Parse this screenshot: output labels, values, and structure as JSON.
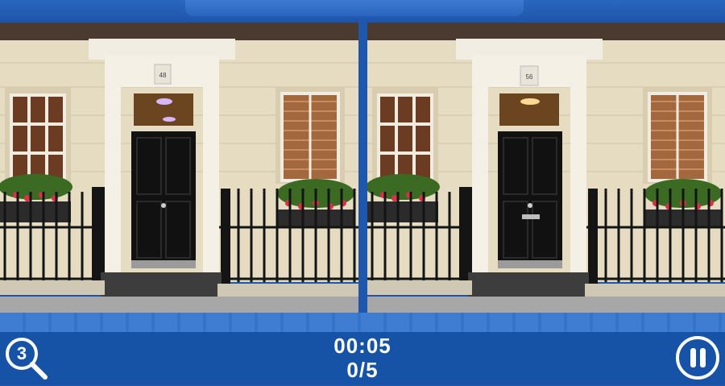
{
  "hud": {
    "timer": "00:05",
    "score": "0/5",
    "hints_remaining": "3"
  },
  "scene": {
    "left_house_number": "48",
    "right_house_number": "56"
  },
  "colors": {
    "frame_blue": "#1f57ad",
    "door_black": "#111111",
    "flower_red": "#d8314a"
  }
}
